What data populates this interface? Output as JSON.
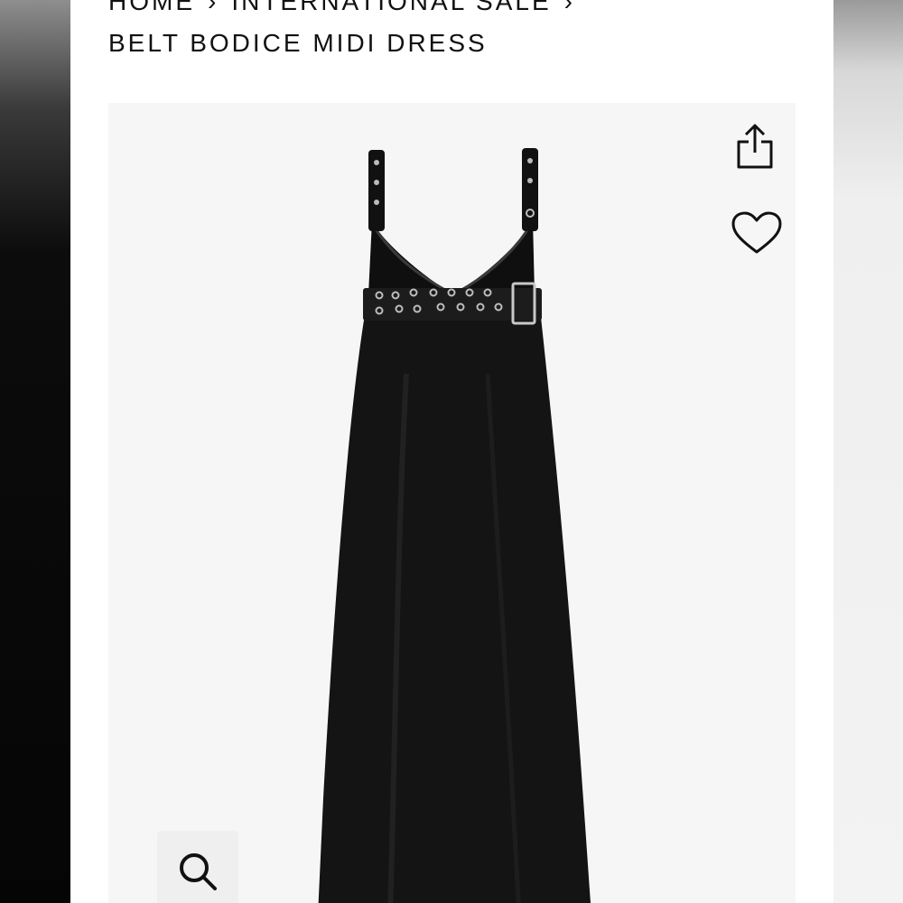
{
  "breadcrumb": {
    "items": [
      "HOME",
      "INTERNATIONAL SALE"
    ],
    "separator": "›"
  },
  "product": {
    "title": "BELT BODICE MIDI DRESS",
    "image_alt": "black midi dress with leather belt bodice"
  },
  "icons": {
    "share": "share-icon",
    "wishlist": "heart-icon",
    "zoom": "search-icon"
  },
  "colors": {
    "page_bg": "#ffffff",
    "gallery_bg": "#f6f6f6",
    "text": "#111111",
    "dress": "#141414"
  }
}
